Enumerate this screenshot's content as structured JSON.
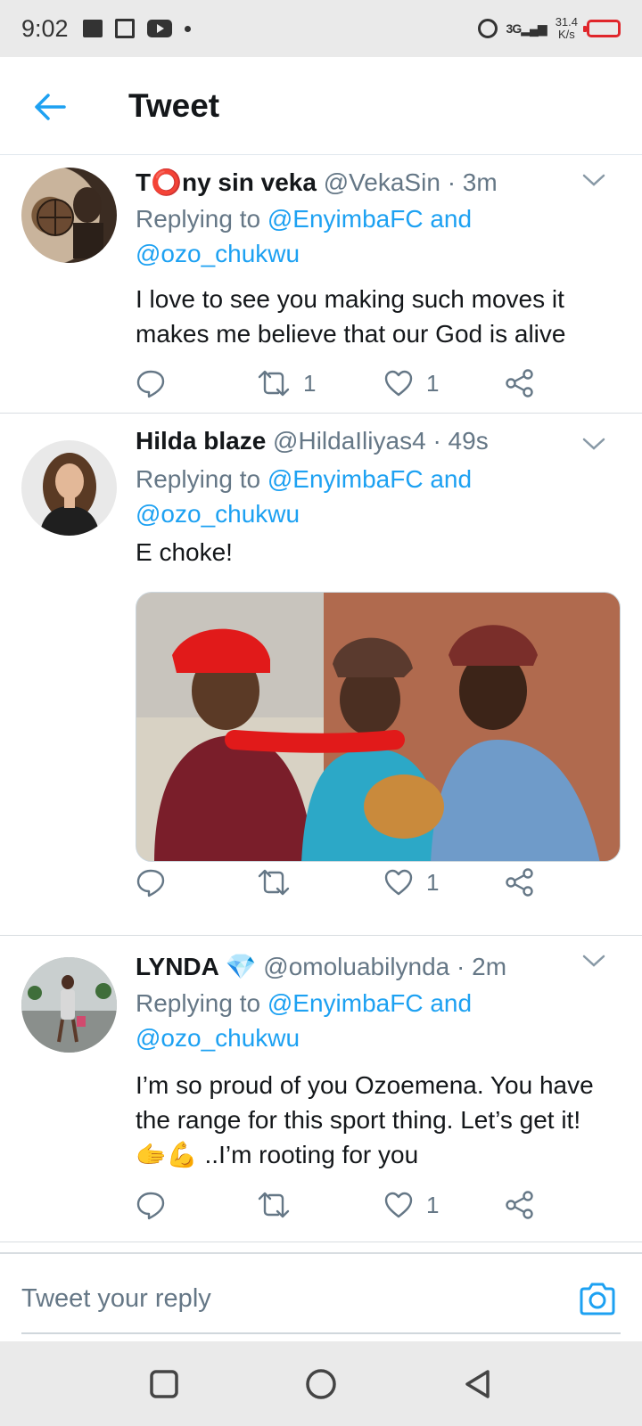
{
  "status_bar": {
    "time": "9:02",
    "signal": "3G",
    "speed_value": "31.4",
    "speed_unit": "K/s"
  },
  "header": {
    "title": "Tweet"
  },
  "tweets": [
    {
      "name": "T⭕ny sin veka",
      "handle": "@VekaSin",
      "time": "3m",
      "replying_prefix": "Replying to",
      "replying_to_1": "@EnyimbaFC and",
      "replying_to_2": "@ozo_chukwu",
      "text_line_1": "I love to see you making such moves it",
      "text_line_2": "makes me believe that our God  is alive",
      "retweets": "1",
      "likes": "1"
    },
    {
      "name": "Hilda blaze",
      "handle": "@HildaIliyas4",
      "time": "49s",
      "replying_prefix": "Replying to",
      "replying_to_1": "@EnyimbaFC and",
      "replying_to_2": "@ozo_chukwu",
      "text_line_1": "E choke!",
      "retweets": "",
      "likes": "1"
    },
    {
      "name": "LYNDA 💎",
      "handle": "@omoluabilynda",
      "time": "2m",
      "replying_prefix": "Replying to",
      "replying_to_1": "@EnyimbaFC and",
      "replying_to_2": "@ozo_chukwu",
      "text_line_1": "I’m so proud of you Ozoemena. You have",
      "text_line_2": "the range for this sport thing. Let’s get it!",
      "text_line_3": "🫱💪 ..I’m rooting for you",
      "retweets": "",
      "likes": "1"
    }
  ],
  "reply_bar": {
    "placeholder": "Tweet your reply"
  },
  "colors": {
    "accent": "#1da1f2",
    "secondary_text": "#657786",
    "primary_text": "#14171a",
    "battery": "#e0262b"
  },
  "icons": [
    "image-icon",
    "news-icon",
    "youtube-icon",
    "alarm-icon",
    "battery-icon",
    "back-arrow-icon",
    "chevron-down-icon",
    "reply-icon",
    "retweet-icon",
    "like-icon",
    "share-icon",
    "camera-icon",
    "square-icon",
    "circle-icon",
    "triangle-back-icon"
  ]
}
